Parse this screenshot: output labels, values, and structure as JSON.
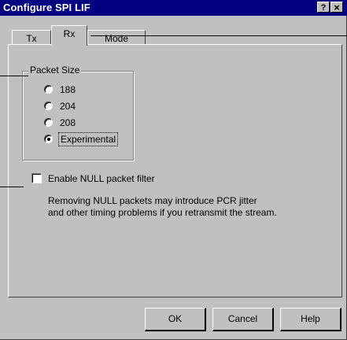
{
  "window": {
    "title": "Configure SPI LIF",
    "help_button": "?",
    "close_button": "×"
  },
  "tabs": [
    {
      "label": "Tx"
    },
    {
      "label": "Rx"
    },
    {
      "label": "Mode"
    }
  ],
  "packet_size": {
    "group_label": "Packet Size",
    "options": [
      {
        "label": "188",
        "selected": false
      },
      {
        "label": "204",
        "selected": false
      },
      {
        "label": "208",
        "selected": false
      },
      {
        "label": "Experimental",
        "selected": true
      }
    ]
  },
  "null_filter": {
    "label": "Enable NULL packet filter",
    "checked": false,
    "note_line1": "Removing NULL packets may introduce PCR jitter",
    "note_line2": "and other timing problems if you retransmit the stream."
  },
  "buttons": {
    "ok": "OK",
    "cancel": "Cancel",
    "help": "Help"
  }
}
